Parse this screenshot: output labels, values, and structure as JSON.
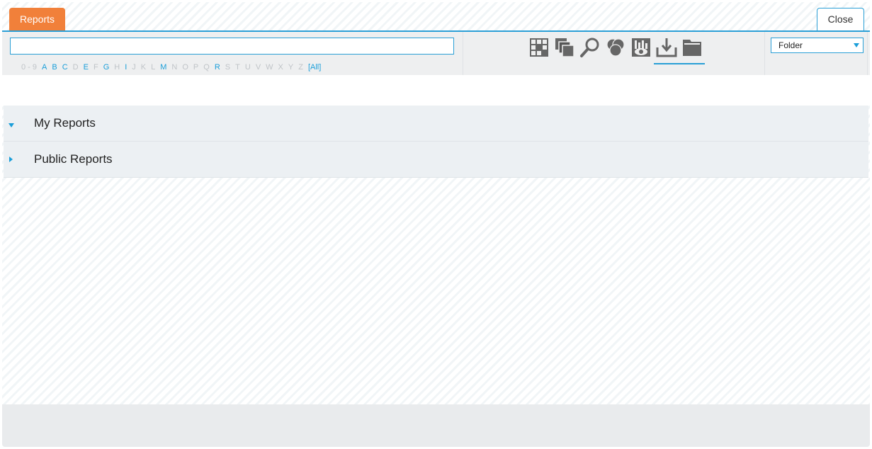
{
  "tabs": {
    "reports_label": "Reports",
    "close_label": "Close"
  },
  "search": {
    "value": "",
    "placeholder": ""
  },
  "alphabet": [
    {
      "label": "0 - 9",
      "active": false
    },
    {
      "label": "A",
      "active": true
    },
    {
      "label": "B",
      "active": true
    },
    {
      "label": "C",
      "active": true
    },
    {
      "label": "D",
      "active": false
    },
    {
      "label": "E",
      "active": true
    },
    {
      "label": "F",
      "active": false
    },
    {
      "label": "G",
      "active": true
    },
    {
      "label": "H",
      "active": false
    },
    {
      "label": "I",
      "active": true
    },
    {
      "label": "J",
      "active": false
    },
    {
      "label": "K",
      "active": false
    },
    {
      "label": "L",
      "active": false
    },
    {
      "label": "M",
      "active": true
    },
    {
      "label": "N",
      "active": false
    },
    {
      "label": "O",
      "active": false
    },
    {
      "label": "P",
      "active": false
    },
    {
      "label": "Q",
      "active": false
    },
    {
      "label": "R",
      "active": true
    },
    {
      "label": "S",
      "active": false
    },
    {
      "label": "T",
      "active": false
    },
    {
      "label": "U",
      "active": false
    },
    {
      "label": "V",
      "active": false
    },
    {
      "label": "W",
      "active": false
    },
    {
      "label": "X",
      "active": false
    },
    {
      "label": "Y",
      "active": false
    },
    {
      "label": "Z",
      "active": false
    },
    {
      "label": "[All]",
      "active": true
    }
  ],
  "toolbar_icons": [
    "grid-report-icon",
    "copy-icon",
    "search-icon",
    "venn-diagram-icon",
    "view-report-icon",
    "download-icon",
    "folder-icon"
  ],
  "folder_select": {
    "value": "Folder"
  },
  "sections": [
    {
      "label": "My Reports",
      "expanded": true
    },
    {
      "label": "Public Reports",
      "expanded": false
    }
  ],
  "colors": {
    "accent": "#2a9fd6",
    "tab_orange": "#f1803a",
    "icon_gray": "#666666"
  }
}
